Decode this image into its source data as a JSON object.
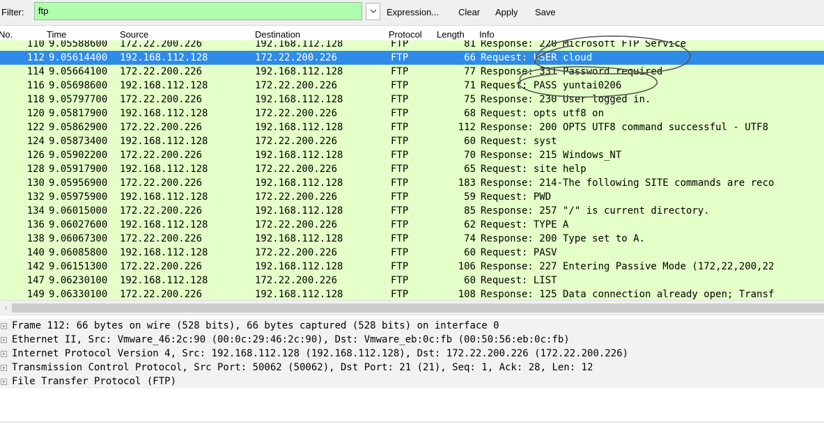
{
  "toolbar": {
    "filter_label": "Filter:",
    "filter_value": "ftp",
    "expression": "Expression...",
    "clear": "Clear",
    "apply": "Apply",
    "save": "Save"
  },
  "columns": [
    "No.",
    "Time",
    "Source",
    "Destination",
    "Protocol",
    "Length",
    "Info"
  ],
  "packets": [
    {
      "no": "110",
      "time": "9.05588600",
      "src": "172.22.200.226",
      "dst": "192.168.112.128",
      "proto": "FTP",
      "len": "81",
      "info": "Response: 220 Microsoft FTP Service"
    },
    {
      "no": "112",
      "time": "9.05614400",
      "src": "192.168.112.128",
      "dst": "172.22.200.226",
      "proto": "FTP",
      "len": "66",
      "info": "Request: USER cloud"
    },
    {
      "no": "114",
      "time": "9.05664100",
      "src": "172.22.200.226",
      "dst": "192.168.112.128",
      "proto": "FTP",
      "len": "77",
      "info": "Response: 331 Password required"
    },
    {
      "no": "116",
      "time": "9.05698600",
      "src": "192.168.112.128",
      "dst": "172.22.200.226",
      "proto": "FTP",
      "len": "71",
      "info": "Request: PASS yuntai0206"
    },
    {
      "no": "118",
      "time": "9.05797700",
      "src": "172.22.200.226",
      "dst": "192.168.112.128",
      "proto": "FTP",
      "len": "75",
      "info": "Response: 230 User logged in."
    },
    {
      "no": "120",
      "time": "9.05817900",
      "src": "192.168.112.128",
      "dst": "172.22.200.226",
      "proto": "FTP",
      "len": "68",
      "info": "Request: opts utf8 on"
    },
    {
      "no": "122",
      "time": "9.05862900",
      "src": "172.22.200.226",
      "dst": "192.168.112.128",
      "proto": "FTP",
      "len": "112",
      "info": "Response: 200 OPTS UTF8 command successful - UTF8"
    },
    {
      "no": "124",
      "time": "9.05873400",
      "src": "192.168.112.128",
      "dst": "172.22.200.226",
      "proto": "FTP",
      "len": "60",
      "info": "Request: syst"
    },
    {
      "no": "126",
      "time": "9.05902200",
      "src": "172.22.200.226",
      "dst": "192.168.112.128",
      "proto": "FTP",
      "len": "70",
      "info": "Response: 215 Windows_NT"
    },
    {
      "no": "128",
      "time": "9.05917900",
      "src": "192.168.112.128",
      "dst": "172.22.200.226",
      "proto": "FTP",
      "len": "65",
      "info": "Request: site help"
    },
    {
      "no": "130",
      "time": "9.05956900",
      "src": "172.22.200.226",
      "dst": "192.168.112.128",
      "proto": "FTP",
      "len": "183",
      "info": "Response: 214-The following SITE commands are reco"
    },
    {
      "no": "132",
      "time": "9.05975900",
      "src": "192.168.112.128",
      "dst": "172.22.200.226",
      "proto": "FTP",
      "len": "59",
      "info": "Request: PWD"
    },
    {
      "no": "134",
      "time": "9.06015000",
      "src": "172.22.200.226",
      "dst": "192.168.112.128",
      "proto": "FTP",
      "len": "85",
      "info": "Response: 257 \"/\" is current directory."
    },
    {
      "no": "136",
      "time": "9.06027600",
      "src": "192.168.112.128",
      "dst": "172.22.200.226",
      "proto": "FTP",
      "len": "62",
      "info": "Request: TYPE A"
    },
    {
      "no": "138",
      "time": "9.06067300",
      "src": "172.22.200.226",
      "dst": "192.168.112.128",
      "proto": "FTP",
      "len": "74",
      "info": "Response: 200 Type set to A."
    },
    {
      "no": "140",
      "time": "9.06085800",
      "src": "192.168.112.128",
      "dst": "172.22.200.226",
      "proto": "FTP",
      "len": "60",
      "info": "Request: PASV"
    },
    {
      "no": "142",
      "time": "9.06151300",
      "src": "172.22.200.226",
      "dst": "192.168.112.128",
      "proto": "FTP",
      "len": "106",
      "info": "Response: 227 Entering Passive Mode (172,22,200,22"
    },
    {
      "no": "147",
      "time": "9.06230100",
      "src": "192.168.112.128",
      "dst": "172.22.200.226",
      "proto": "FTP",
      "len": "60",
      "info": "Request: LIST"
    },
    {
      "no": "149",
      "time": "9.06330100",
      "src": "172.22.200.226",
      "dst": "192.168.112.128",
      "proto": "FTP",
      "len": "108",
      "info": "Response: 125 Data connection already open; Transf"
    }
  ],
  "selected_packet": "112",
  "details": [
    "Frame 112: 66 bytes on wire (528 bits), 66 bytes captured (528 bits) on interface 0",
    "Ethernet II, Src: Vmware_46:2c:90 (00:0c:29:46:2c:90), Dst: Vmware_eb:0c:fb (00:50:56:eb:0c:fb)",
    "Internet Protocol Version 4, Src: 192.168.112.128 (192.168.112.128), Dst: 172.22.200.226 (172.22.200.226)",
    "Transmission Control Protocol, Src Port: 50062 (50062), Dst Port: 21 (21), Seq: 1, Ack: 28, Len: 12",
    "File Transfer Protocol (FTP)"
  ],
  "expander_symbol": "+",
  "colors": {
    "ftp_row": "#e4ffc7",
    "selected_row": "#2f8be8",
    "filter_ok": "#afffaf",
    "annotation_ink": "#555555"
  }
}
